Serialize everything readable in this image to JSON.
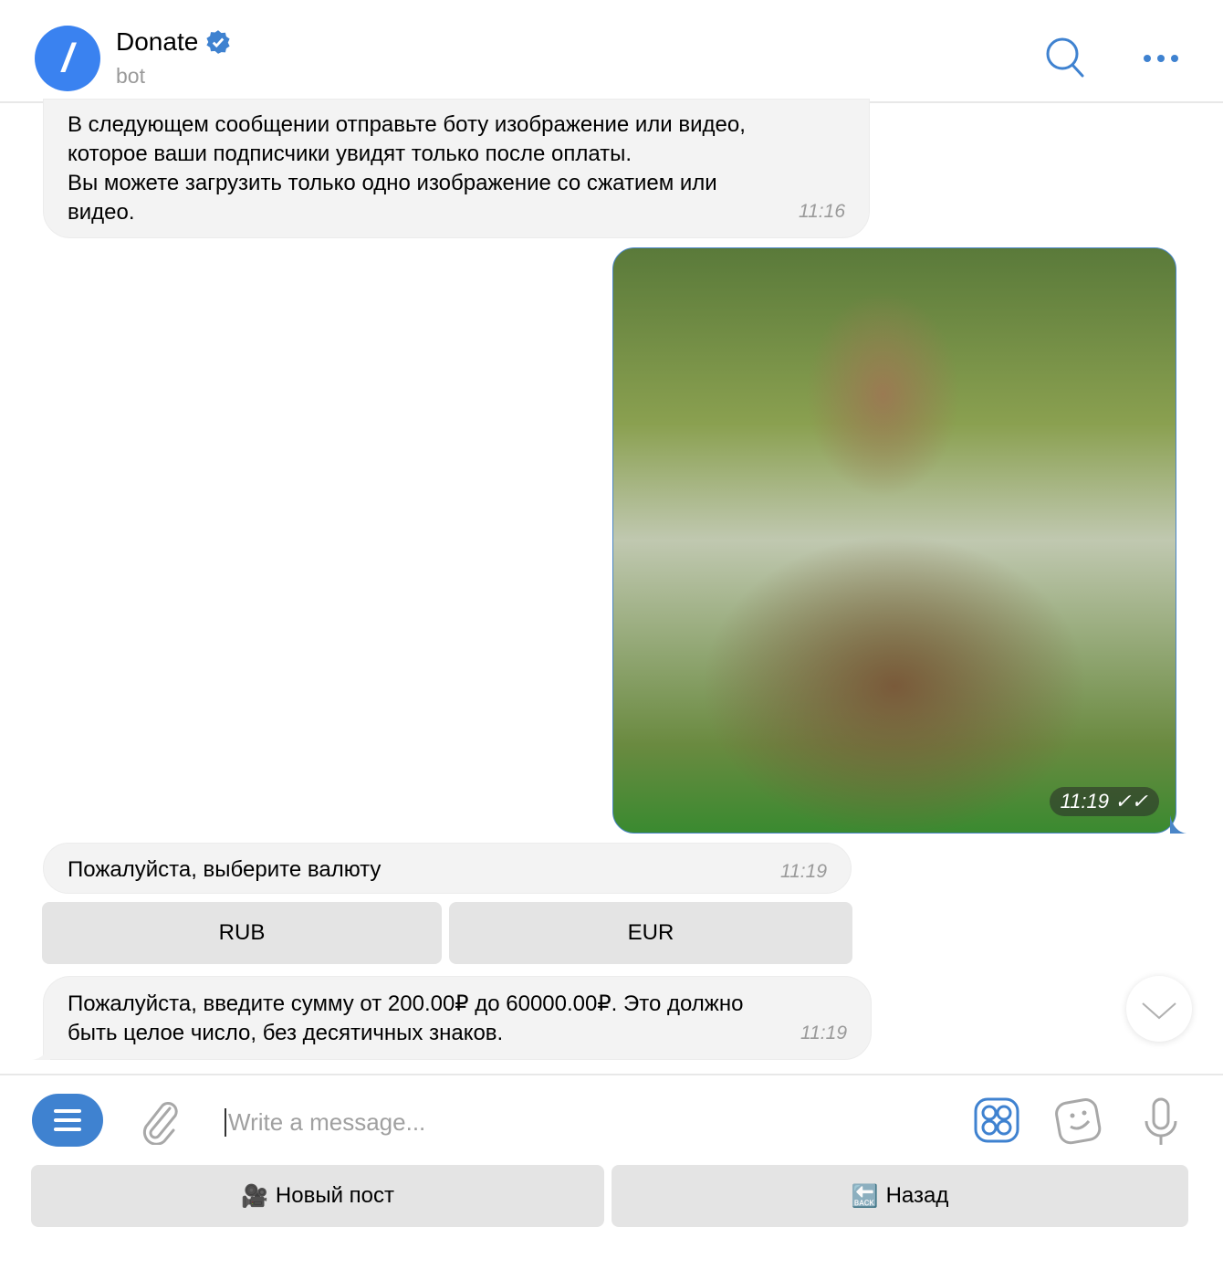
{
  "header": {
    "avatar_letter": "/",
    "title": "Donate",
    "subtitle": "bot",
    "verified": true,
    "icons": [
      "search-icon",
      "more-icon"
    ]
  },
  "messages": [
    {
      "lines": [
        "В следующем сообщении отправьте боту изображение или видео,",
        "которое ваши подписчики увидят только после оплаты.",
        "Вы можете загрузить только одно изображение со сжатием или",
        "видео."
      ],
      "time": "11:16"
    },
    {
      "type": "photo",
      "time": "11:19",
      "status": "read"
    },
    {
      "lines": [
        "Пожалуйста, выберите валюту"
      ],
      "time": "11:19",
      "buttons": [
        "RUB",
        "EUR"
      ]
    },
    {
      "lines": [
        "Пожалуйста, введите сумму от 200.00₽ до 60000.00₽. Это должно",
        "быть целое число, без десятичных знаков."
      ],
      "time": "11:19"
    }
  ],
  "input": {
    "placeholder": "Write a message..."
  },
  "keyboard": [
    {
      "emoji": "🎥",
      "label": "Новый пост"
    },
    {
      "emoji": "🔙",
      "label": "Назад"
    }
  ],
  "colors": {
    "accent": "#3f82d0",
    "bubble": "#f3f3f3",
    "button": "#e4e4e4"
  }
}
